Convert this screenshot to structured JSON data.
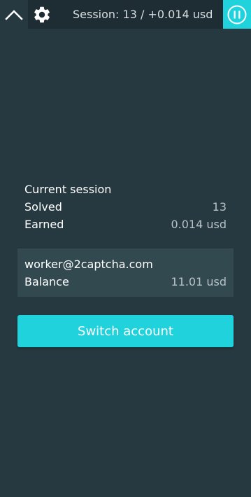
{
  "colors": {
    "background": "#263940",
    "topbar": "#1e2d33",
    "accent": "#20d2dc",
    "card": "#334950",
    "muted_text": "#b8c3c7"
  },
  "topbar": {
    "collapse_icon": "chevron-up-icon",
    "settings_icon": "gear-icon",
    "session_summary": "Session: 13 / +0.014 usd",
    "pause_icon": "pause-icon"
  },
  "session": {
    "heading": "Current session",
    "solved_label": "Solved",
    "solved_value": "13",
    "earned_label": "Earned",
    "earned_value": "0.014 usd"
  },
  "account": {
    "email": "worker@2captcha.com",
    "balance_label": "Balance",
    "balance_value": "11.01 usd"
  },
  "actions": {
    "switch_account_label": "Switch account"
  }
}
